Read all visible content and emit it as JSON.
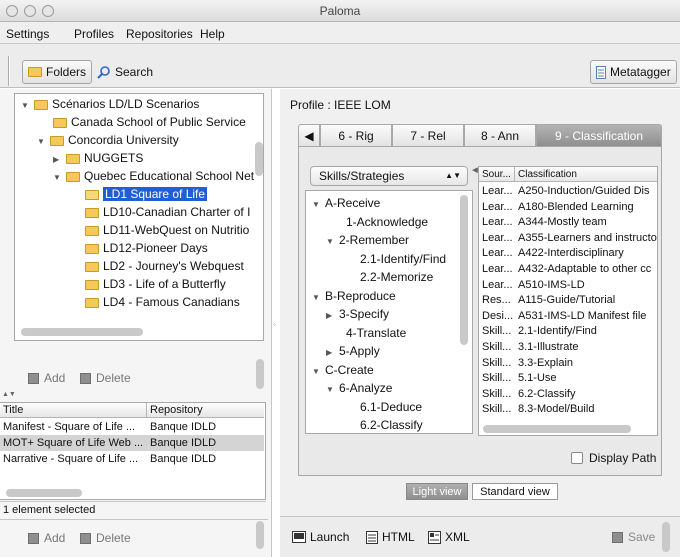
{
  "window": {
    "title": "Paloma"
  },
  "menubar": [
    "Settings",
    "Profiles",
    "Repositories",
    "Help"
  ],
  "toolbar": {
    "folders": "Folders",
    "search": "Search",
    "metatagger": "Metatagger"
  },
  "tree": [
    {
      "label": "Scénarios LD/LD Scenarios",
      "expander": "▼",
      "selected": false
    },
    {
      "label": "Canada School of Public Service",
      "expander": "",
      "selected": false
    },
    {
      "label": "Concordia University",
      "expander": "▼",
      "selected": false
    },
    {
      "label": "NUGGETS",
      "expander": "▶",
      "selected": false
    },
    {
      "label": "Quebec Educational School Net",
      "expander": "▼",
      "selected": false
    },
    {
      "label": "LD1 Square of Life",
      "expander": "",
      "selected": true
    },
    {
      "label": "LD10-Canadian Charter of I",
      "expander": "",
      "selected": false
    },
    {
      "label": "LD11-WebQuest on Nutritio",
      "expander": "",
      "selected": false
    },
    {
      "label": "LD12-Pioneer Days",
      "expander": "",
      "selected": false
    },
    {
      "label": "LD2 - Journey's Webquest",
      "expander": "",
      "selected": false
    },
    {
      "label": "LD3 - Life of a Butterfly",
      "expander": "",
      "selected": false
    },
    {
      "label": "LD4 - Famous Canadians",
      "expander": "",
      "selected": false
    }
  ],
  "left_actions": {
    "add": "Add",
    "delete": "Delete"
  },
  "resources_table": {
    "headers": [
      "Title",
      "Repository"
    ],
    "rows": [
      {
        "title": "Manifest - Square of Life ...",
        "repository": "Banque IDLD",
        "selected": false
      },
      {
        "title": "MOT+ Square of Life Web ...",
        "repository": "Banque IDLD",
        "selected": true
      },
      {
        "title": "Narrative - Square of Life ...",
        "repository": "Banque IDLD",
        "selected": false
      }
    ]
  },
  "selection_status": "1 element selected",
  "profile_label": "Profile : IEEE LOM",
  "tabs": [
    "6 - Rig",
    "7 - Rel",
    "8 - Ann",
    "9 - Classification"
  ],
  "active_tab": "9 - Classification",
  "taxonomy_select": "Skills/Strategies",
  "taxonomy_tree": [
    {
      "label": "A-Receive",
      "expander": "▼",
      "level": 0
    },
    {
      "label": "1-Acknowledge",
      "expander": "",
      "level": 1
    },
    {
      "label": "2-Remember",
      "expander": "▼",
      "level": 1
    },
    {
      "label": "2.1-Identify/Find",
      "expander": "",
      "level": 2
    },
    {
      "label": "2.2-Memorize",
      "expander": "",
      "level": 2
    },
    {
      "label": "B-Reproduce",
      "expander": "▼",
      "level": 0
    },
    {
      "label": "3-Specify",
      "expander": "▶",
      "level": 1
    },
    {
      "label": "4-Translate",
      "expander": "",
      "level": 1
    },
    {
      "label": "5-Apply",
      "expander": "▶",
      "level": 1
    },
    {
      "label": "C-Create",
      "expander": "▼",
      "level": 0
    },
    {
      "label": "6-Analyze",
      "expander": "▼",
      "level": 1
    },
    {
      "label": "6.1-Deduce",
      "expander": "",
      "level": 2
    },
    {
      "label": "6.2-Classify",
      "expander": "",
      "level": 2
    }
  ],
  "classification_table": {
    "headers": [
      "Sour...",
      "Classification"
    ],
    "rows": [
      [
        "Lear...",
        "A250-Induction/Guided Dis"
      ],
      [
        "Lear...",
        "A180-Blended Learning"
      ],
      [
        "Lear...",
        "A344-Mostly team"
      ],
      [
        "Lear...",
        "A355-Learners and instructo"
      ],
      [
        "Lear...",
        "A422-Interdisciplinary"
      ],
      [
        "Lear...",
        "A432-Adaptable to other cc"
      ],
      [
        "Lear...",
        "A510-IMS-LD"
      ],
      [
        "Res...",
        "A115-Guide/Tutorial"
      ],
      [
        "Desi...",
        "A531-IMS-LD Manifest file"
      ],
      [
        "Skill...",
        "2.1-Identify/Find"
      ],
      [
        "Skill...",
        "3.1-Illustrate"
      ],
      [
        "Skill...",
        "3.3-Explain"
      ],
      [
        "Skill...",
        "5.1-Use"
      ],
      [
        "Skill...",
        "6.2-Classify"
      ],
      [
        "Skill...",
        "8.3-Model/Build"
      ]
    ]
  },
  "display_path": "Display Path",
  "view_buttons": {
    "light": "Light view",
    "standard": "Standard view"
  },
  "bottom_toolbar": {
    "launch": "Launch",
    "html": "HTML",
    "xml": "XML",
    "save": "Save"
  },
  "colors": {
    "selection": "#1e5fd6",
    "active_tab": "#9e9e9e"
  }
}
